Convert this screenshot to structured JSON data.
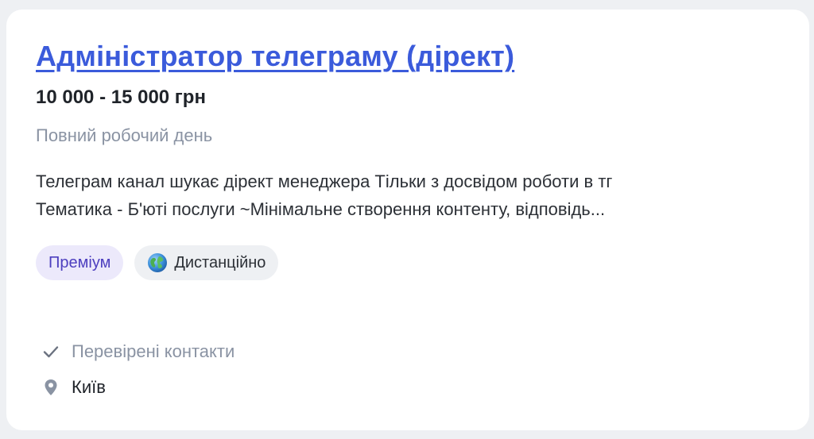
{
  "vacancy": {
    "title": "Адміністратор телеграму (дірект)",
    "salary": "10 000 - 15 000 грн",
    "employment": "Повний робочий день",
    "description_lines": [
      "Телеграм канал шукає дірект менеджера Тільки з досвідом роботи в тг",
      "Тематика - Б'юті послуги ~Мінімальне створення контенту, відповідь..."
    ],
    "tags": {
      "premium": "Преміум",
      "remote": "Дистанційно"
    },
    "meta": {
      "verified": "Перевірені контакти",
      "city": "Київ"
    }
  },
  "icons": {
    "globe": "globe-icon",
    "check": "check-icon",
    "location": "location-pin-icon"
  },
  "colors": {
    "title_link": "#3b5bdb",
    "premium_bg": "#ece9fb",
    "premium_text": "#4d3fbf",
    "muted": "#8a93a3",
    "page_bg": "#eef0f3"
  }
}
